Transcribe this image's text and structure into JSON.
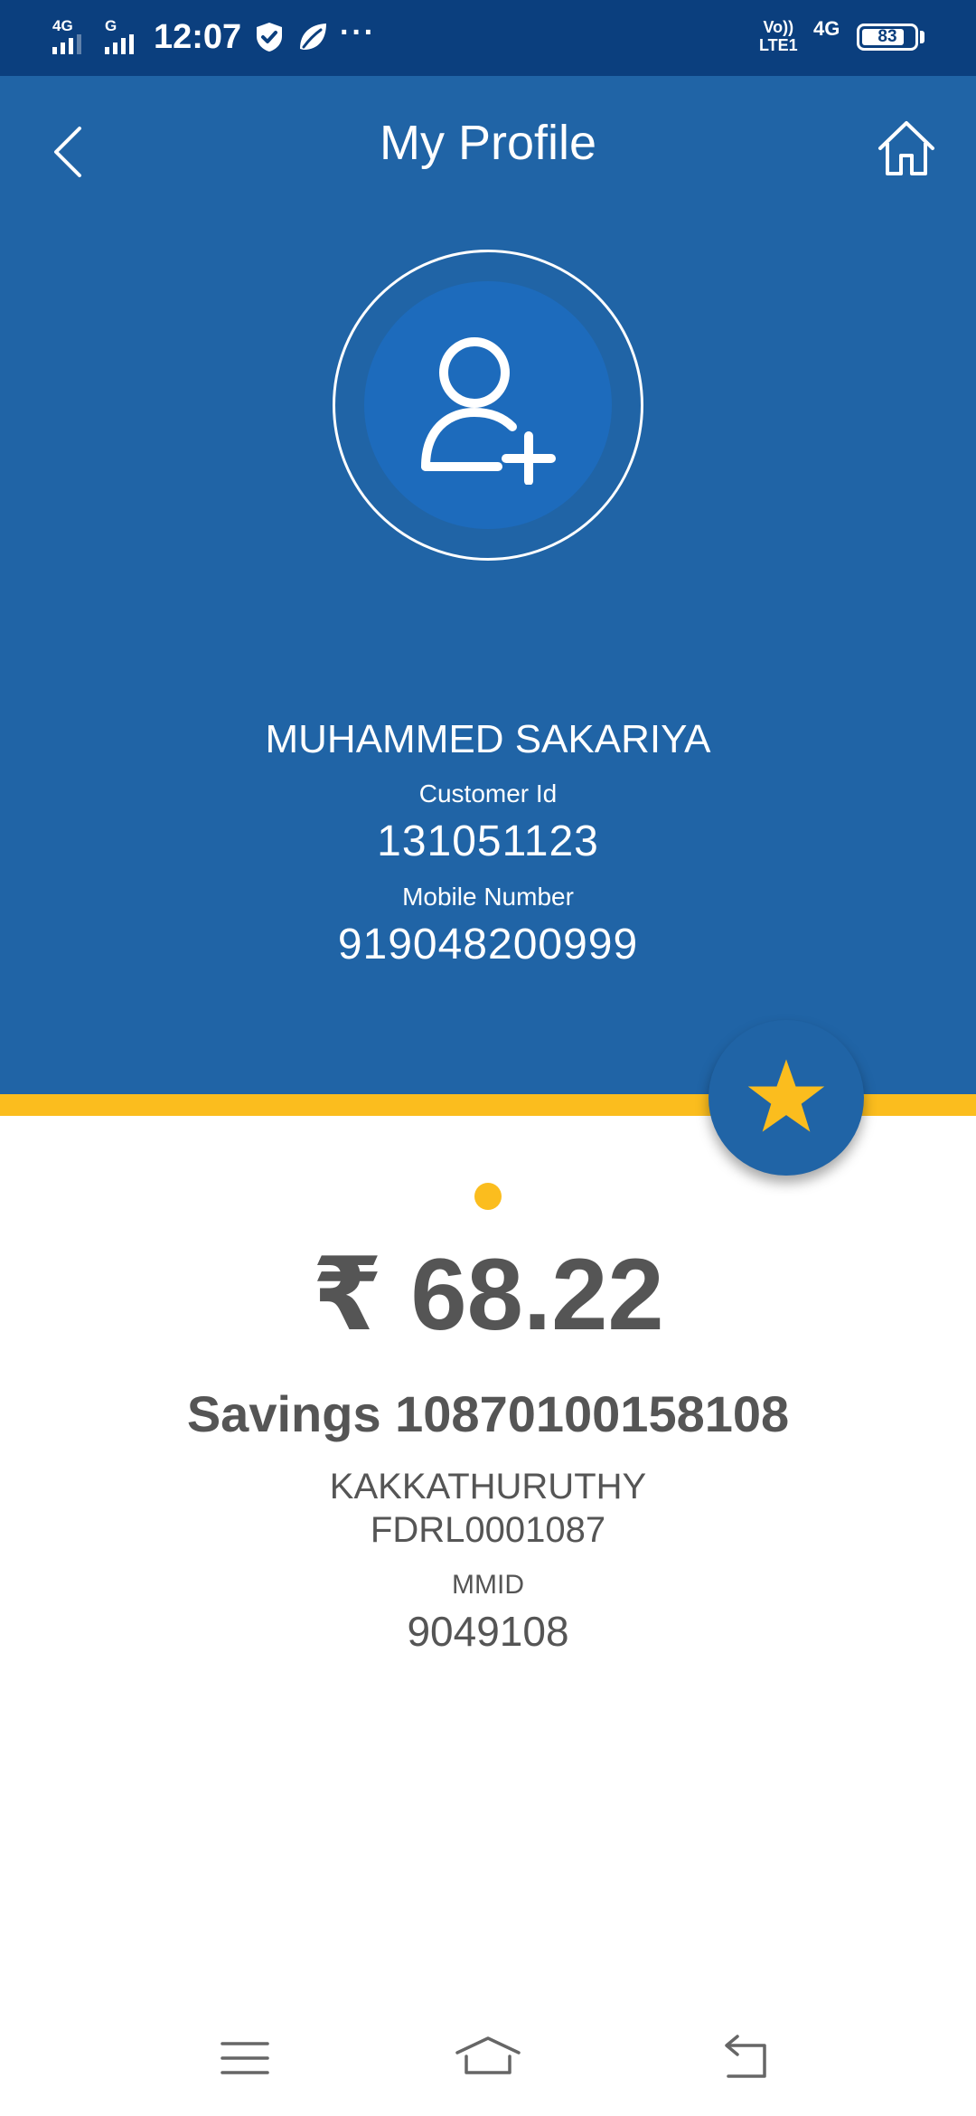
{
  "status_bar": {
    "network1": "4G",
    "network2": "G",
    "time": "12:07",
    "more": "···",
    "volte_top": "Vo))",
    "volte_bottom": "LTE1",
    "network3": "4G",
    "battery": "83",
    "battery_level": 0.83
  },
  "header": {
    "title": "My Profile",
    "back_icon": "chevron-left-icon",
    "home_icon": "home-icon"
  },
  "profile": {
    "avatar_icon": "add-user-icon",
    "name": "MUHAMMED SAKARIYA",
    "customer_id_label": "Customer Id",
    "customer_id": "131051123",
    "mobile_label": "Mobile Number",
    "mobile": "919048200999"
  },
  "favorite": {
    "icon": "star-icon"
  },
  "account": {
    "balance": "₹ 68.22",
    "title": "Savings 10870100158108",
    "branch": "KAKKATHURUTHY",
    "ifsc": "FDRL0001087",
    "mmid_label": "MMID",
    "mmid": "9049108"
  },
  "nav": {
    "menu_icon": "menu-icon",
    "home_icon": "home-icon",
    "back_icon": "back-icon"
  },
  "colors": {
    "status_bar": "#0b3f7e",
    "header_blue": "#2064a6",
    "avatar_blue": "#1d6bbc",
    "accent_yellow": "#fbbd1e",
    "text_gray": "#555555"
  }
}
